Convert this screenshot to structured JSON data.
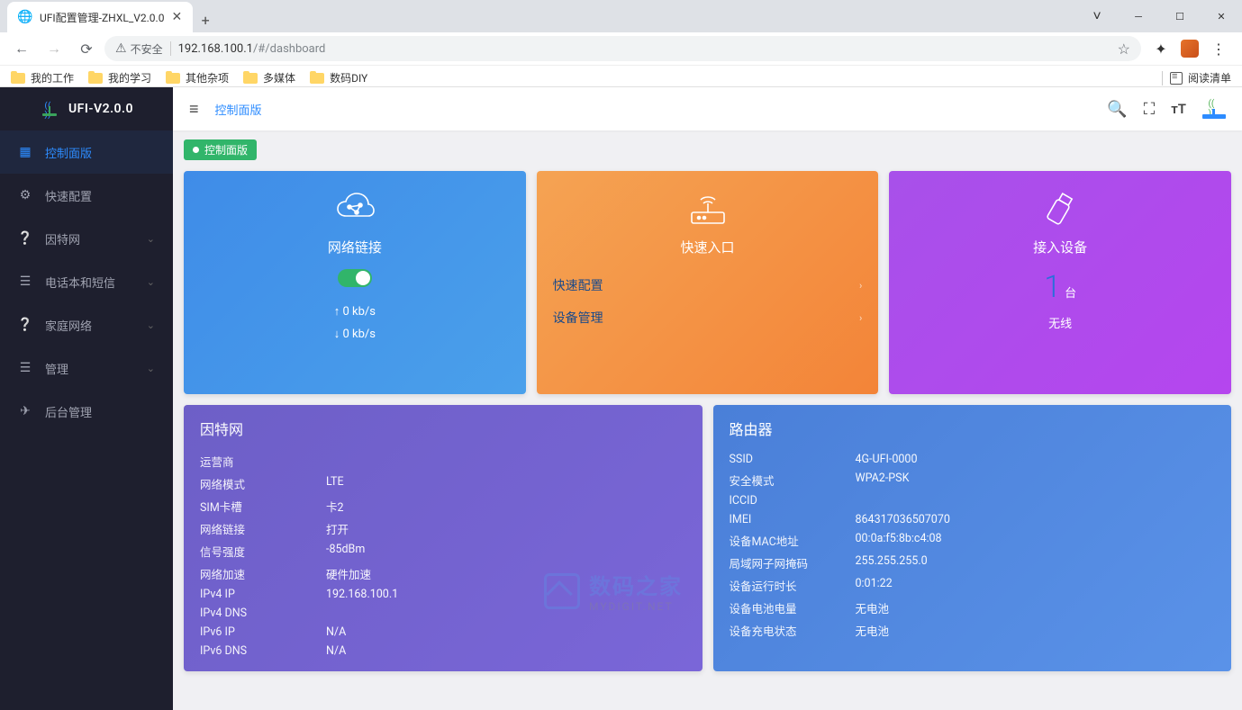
{
  "browser": {
    "tab_title": "UFI配置管理-ZHXL_V2.0.0",
    "insecure_label": "不安全",
    "url_host": "192.168.100.1",
    "url_path": "/#/dashboard",
    "bookmarks": [
      "我的工作",
      "我的学习",
      "其他杂项",
      "多媒体",
      "数码DIY"
    ],
    "reading_list": "阅读清单"
  },
  "sidebar": {
    "logo": "UFI-V2.0.0",
    "items": [
      {
        "icon": "grid",
        "label": "控制面版",
        "active": true
      },
      {
        "icon": "gear",
        "label": "快速配置"
      },
      {
        "icon": "help",
        "label": "因特网",
        "expandable": true
      },
      {
        "icon": "list",
        "label": "电话本和短信",
        "expandable": true
      },
      {
        "icon": "help",
        "label": "家庭网络",
        "expandable": true
      },
      {
        "icon": "list",
        "label": "管理",
        "expandable": true
      },
      {
        "icon": "send",
        "label": "后台管理"
      }
    ]
  },
  "topbar": {
    "breadcrumb": "控制面版"
  },
  "badge": "控制面版",
  "cards": {
    "network": {
      "title": "网络链接",
      "up": "↑ 0 kb/s",
      "down": "↓  0 kb/s"
    },
    "quick": {
      "title": "快速入口",
      "items": [
        "快速配置",
        "设备管理"
      ]
    },
    "devices": {
      "title": "接入设备",
      "count": "1",
      "unit": "台",
      "label": "无线"
    }
  },
  "internet": {
    "title": "因特网",
    "rows": [
      {
        "k": "运营商",
        "v": ""
      },
      {
        "k": "网络模式",
        "v": "LTE"
      },
      {
        "k": "SIM卡槽",
        "v": "卡2"
      },
      {
        "k": "网络链接",
        "v": "打开"
      },
      {
        "k": "信号强度",
        "v": "-85dBm"
      },
      {
        "k": "网络加速",
        "v": "硬件加速"
      },
      {
        "k": "IPv4 IP",
        "v": "192.168.100.1"
      },
      {
        "k": "IPv4 DNS",
        "v": ""
      },
      {
        "k": "IPv6 IP",
        "v": "N/A"
      },
      {
        "k": "IPv6 DNS",
        "v": "N/A"
      }
    ]
  },
  "router": {
    "title": "路由器",
    "rows": [
      {
        "k": "SSID",
        "v": "4G-UFI-0000"
      },
      {
        "k": "安全模式",
        "v": "WPA2-PSK"
      },
      {
        "k": "ICCID",
        "v": ""
      },
      {
        "k": "IMEI",
        "v": "864317036507070"
      },
      {
        "k": "设备MAC地址",
        "v": "00:0a:f5:8b:c4:08"
      },
      {
        "k": "局域网子网掩码",
        "v": "255.255.255.0"
      },
      {
        "k": "设备运行时长",
        "v": "0:01:22"
      },
      {
        "k": "设备电池电量",
        "v": "无电池"
      },
      {
        "k": "设备充电状态",
        "v": "无电池"
      }
    ]
  },
  "watermark": {
    "big": "数码之家",
    "small": "MYDIGIT.NET"
  }
}
